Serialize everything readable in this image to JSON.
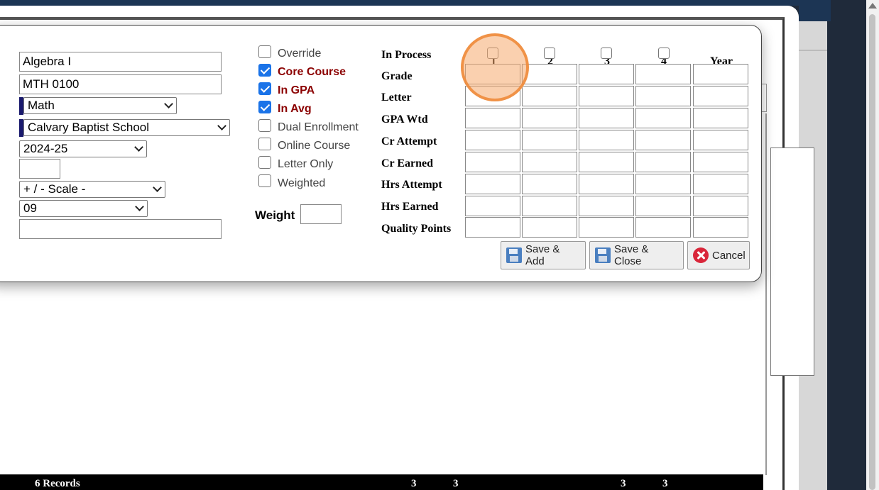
{
  "form": {
    "course_name": "Algebra I",
    "course_code": "MTH 0100",
    "subject": "Math",
    "school": "Calvary Baptist School",
    "year": "2024-25",
    "small_field": "",
    "scale": "+ / - Scale -",
    "grade_level": "09",
    "notes": ""
  },
  "options": [
    {
      "label": "Override",
      "checked": false,
      "highlight": false
    },
    {
      "label": "Core Course",
      "checked": true,
      "highlight": true
    },
    {
      "label": "In GPA",
      "checked": true,
      "highlight": true
    },
    {
      "label": "In Avg",
      "checked": true,
      "highlight": true
    },
    {
      "label": "Dual Enrollment",
      "checked": false,
      "highlight": false
    },
    {
      "label": "Online Course",
      "checked": false,
      "highlight": false
    },
    {
      "label": "Letter Only",
      "checked": false,
      "highlight": false
    },
    {
      "label": "Weighted",
      "checked": false,
      "highlight": false
    }
  ],
  "weight": {
    "label": "Weight",
    "value": ""
  },
  "grid": {
    "columns": [
      "1",
      "2",
      "3",
      "4",
      "Year"
    ],
    "rows": [
      "In Process",
      "Grade",
      "Letter",
      "GPA Wtd",
      "Cr Attempt",
      "Cr Earned",
      "Hrs Attempt",
      "Hrs Earned",
      "Quality Points"
    ]
  },
  "buttons": {
    "save_add": "Save & Add",
    "save_close": "Save & Close",
    "cancel": "Cancel"
  },
  "footer": {
    "records": "6 Records",
    "v1": "3",
    "v2": "3",
    "v3": "3",
    "v4": "3"
  }
}
